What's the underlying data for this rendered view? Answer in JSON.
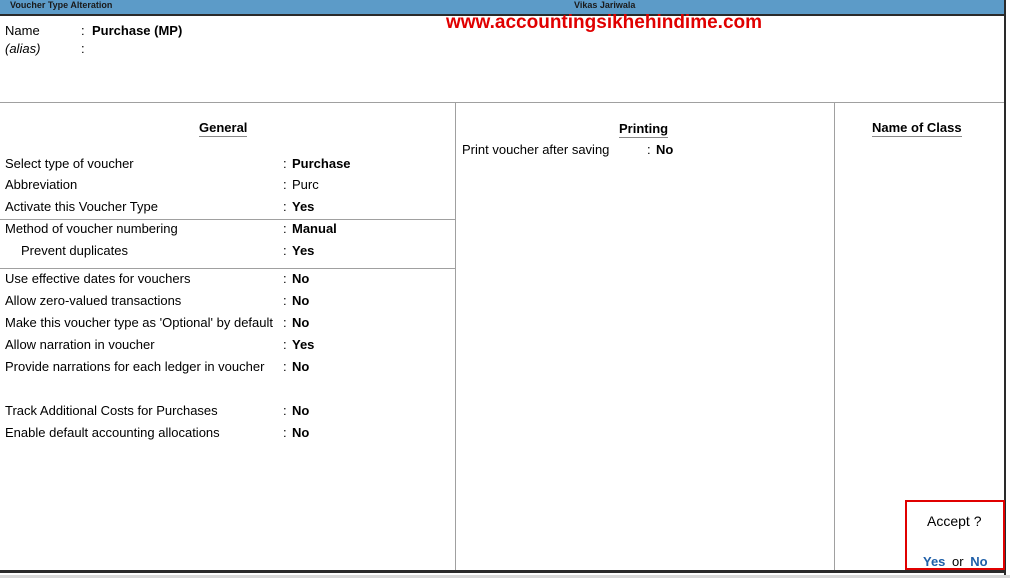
{
  "topbar": {
    "left_title": "Voucher Type Alteration",
    "center_title": "Vikas Jariwala"
  },
  "watermark": "www.accountingsikhehindime.com",
  "header": {
    "name_label": "Name",
    "name_sep": ":",
    "name_value": "Purchase (MP)",
    "alias_label": "(alias)",
    "alias_sep": ":"
  },
  "general": {
    "title": "General",
    "rows": [
      {
        "label": "Select type of voucher",
        "value": "Purchase"
      },
      {
        "label": "Abbreviation",
        "value": "Purc"
      },
      {
        "label": "Activate this Voucher Type",
        "value": "Yes"
      },
      {
        "label": "Method of voucher numbering",
        "value": "Manual"
      },
      {
        "label": "Prevent duplicates",
        "value": "Yes"
      },
      {
        "label": "Use effective dates for vouchers",
        "value": "No"
      },
      {
        "label": "Allow zero-valued transactions",
        "value": "No"
      },
      {
        "label": "Make this voucher type as 'Optional' by default",
        "value": "No"
      },
      {
        "label": "Allow narration in voucher",
        "value": "Yes"
      },
      {
        "label": "Provide narrations for each ledger in voucher",
        "value": "No"
      },
      {
        "label": "Track Additional Costs for Purchases",
        "value": "No"
      },
      {
        "label": "Enable default accounting allocations",
        "value": "No"
      }
    ],
    "sep": ":"
  },
  "printing": {
    "title": "Printing",
    "rows": [
      {
        "label": "Print voucher after saving",
        "value": "No"
      }
    ]
  },
  "class": {
    "title": "Name of Class"
  },
  "accept": {
    "question": "Accept ?",
    "yes": "Yes",
    "or": "or",
    "no": "No"
  },
  "colors": {
    "topbar": "#5c9bc8",
    "watermark": "#e00000",
    "accept_border": "#e00000",
    "link": "#1f5fa8"
  }
}
